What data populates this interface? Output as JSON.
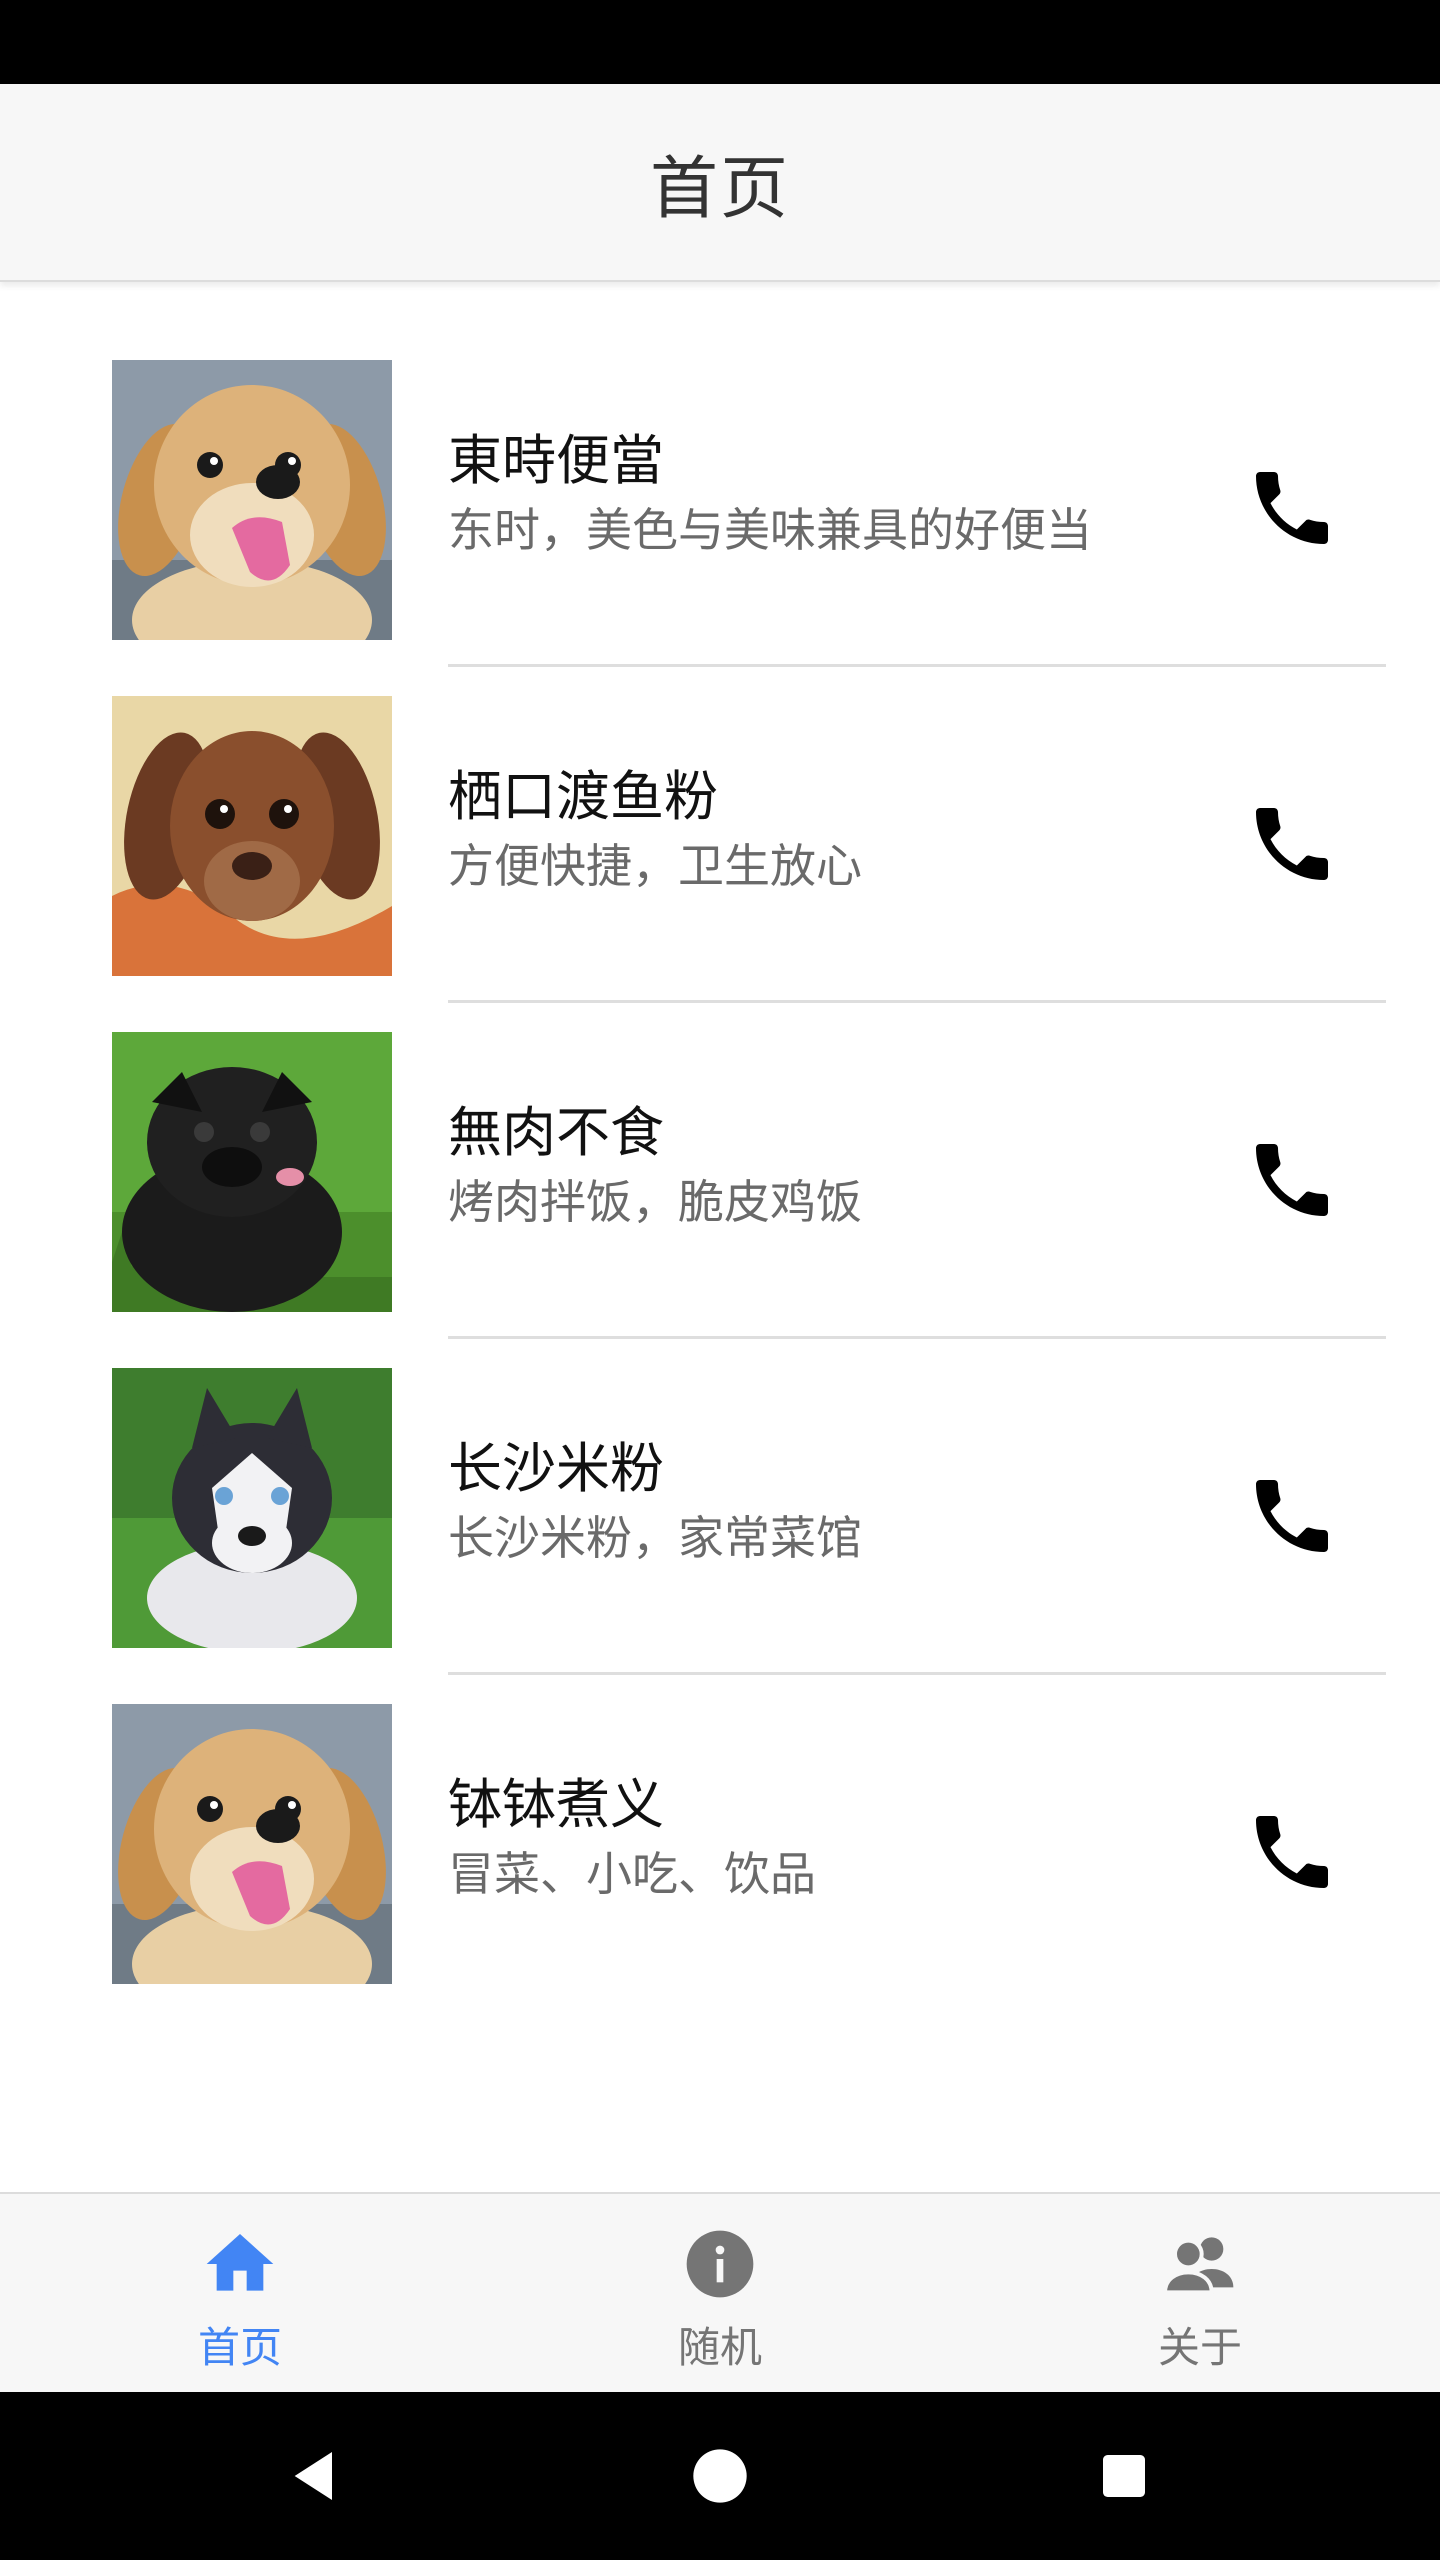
{
  "header": {
    "title": "首页"
  },
  "items": [
    {
      "title": "東時便當",
      "subtitle": "东时，美色与美味兼具的好便当",
      "image": "golden-puppy",
      "action_icon": "phone-icon"
    },
    {
      "title": "栖口渡鱼粉",
      "subtitle": "方便快捷，卫生放心",
      "image": "brown-puppy",
      "action_icon": "phone-icon"
    },
    {
      "title": "無肉不食",
      "subtitle": "烤肉拌饭，脆皮鸡饭",
      "image": "black-pug-puppy",
      "action_icon": "phone-icon"
    },
    {
      "title": "长沙米粉",
      "subtitle": "长沙米粉，家常菜馆",
      "image": "husky-puppy",
      "action_icon": "phone-icon"
    },
    {
      "title": "钵钵煮义",
      "subtitle": "冒菜、小吃、饮品",
      "image": "golden-puppy",
      "action_icon": "phone-icon"
    }
  ],
  "bottom_nav": {
    "home": {
      "label": "首页",
      "icon": "home-icon",
      "active": true
    },
    "random": {
      "label": "随机",
      "icon": "info-icon",
      "active": false
    },
    "about": {
      "label": "关于",
      "icon": "people-icon",
      "active": false
    }
  },
  "colors": {
    "accent": "#4285f4",
    "inactive": "#757575",
    "header_bg": "#f7f7f7"
  }
}
